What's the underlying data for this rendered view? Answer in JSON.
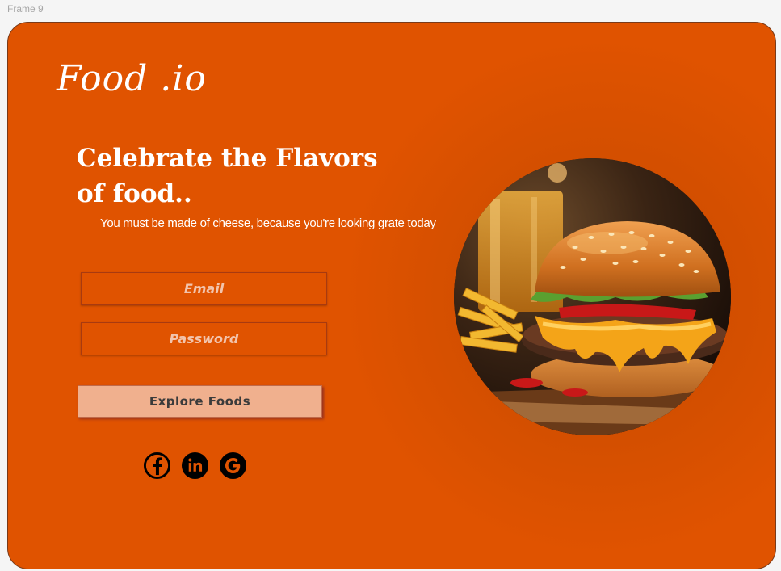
{
  "canvas": {
    "frame_label": "Frame 9"
  },
  "brand": {
    "logo": "Food .io"
  },
  "hero": {
    "headline": "Celebrate the Flavors of food..",
    "tagline": "You must be made of cheese, because you're looking grate today"
  },
  "form": {
    "email_placeholder": "Email",
    "password_placeholder": "Password",
    "submit_label": "Explore Foods"
  },
  "socials": [
    {
      "icon": "facebook-icon"
    },
    {
      "icon": "linkedin-icon"
    },
    {
      "icon": "google-icon"
    }
  ],
  "colors": {
    "card_background": "#e05300",
    "button_background": "#f0b08e",
    "text_primary": "#ffffff",
    "field_text": "#f2c4ad"
  }
}
